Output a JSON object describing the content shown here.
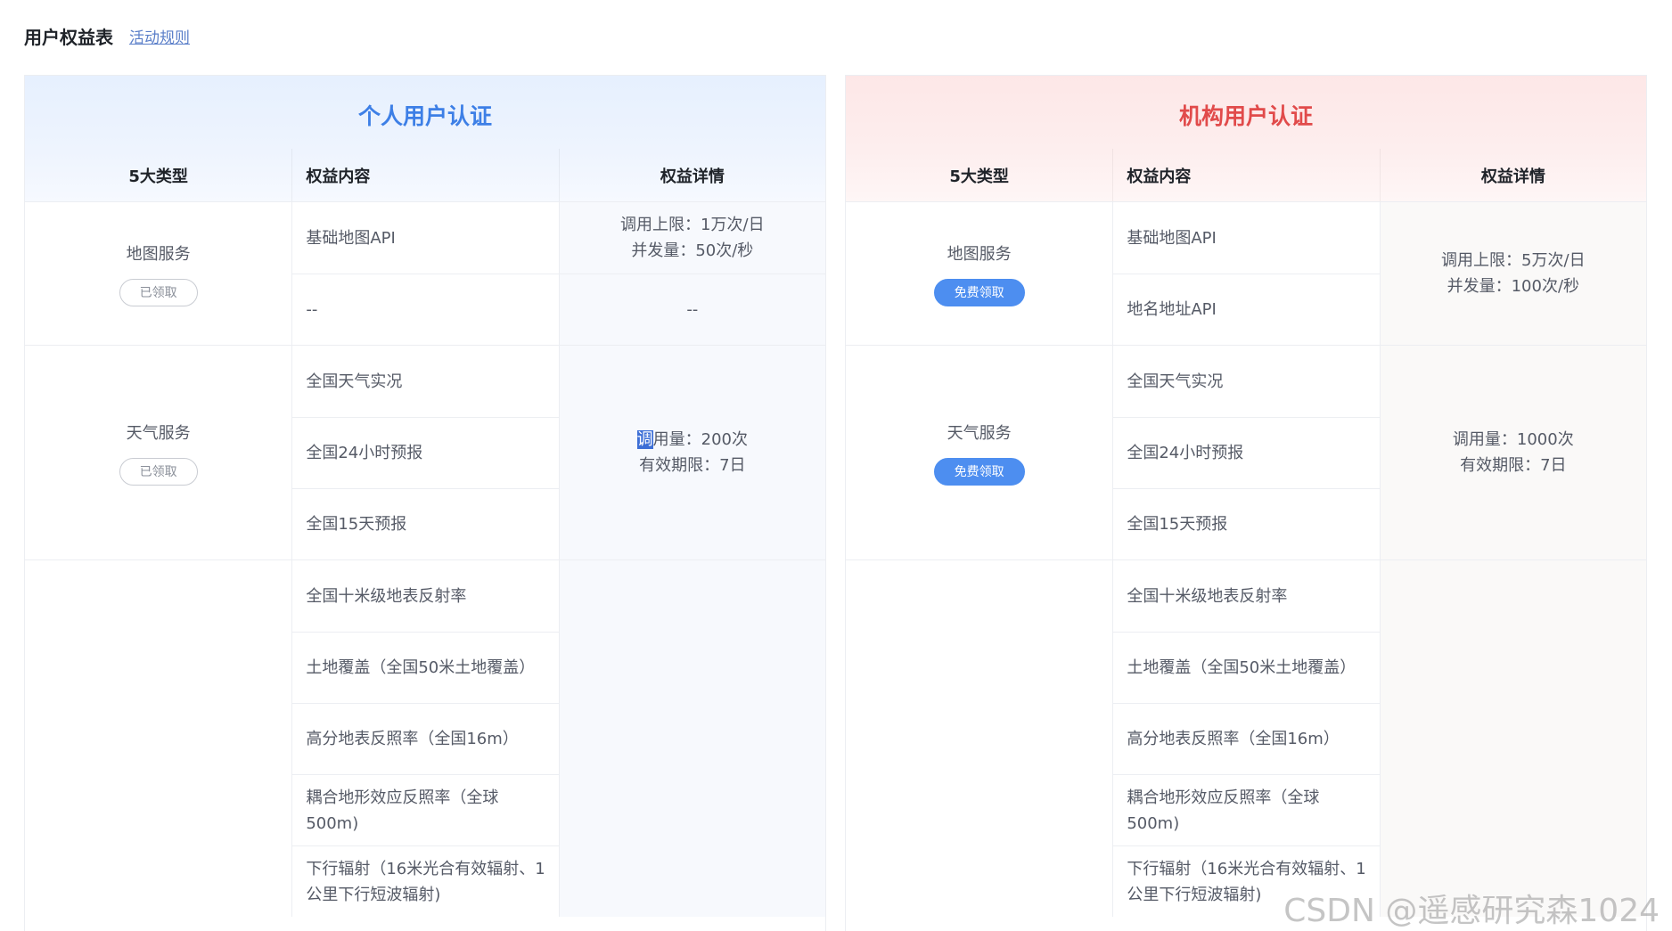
{
  "header": {
    "title": "用户权益表",
    "rules_link": "活动规则"
  },
  "columns": {
    "type": "5大类型",
    "content": "权益内容",
    "detail": "权益详情"
  },
  "personal": {
    "title": "个人用户认证",
    "groups": [
      {
        "type": "地图服务",
        "badge": "已领取",
        "items": [
          "基础地图API",
          "--"
        ],
        "details": [
          [
            "调用上限：1万次/日",
            "并发量：50次/秒"
          ],
          [
            "--"
          ]
        ]
      },
      {
        "type": "天气服务",
        "badge": "已领取",
        "items": [
          "全国天气实况",
          "全国24小时预报",
          "全国15天预报"
        ],
        "detail_highlight": "调",
        "detail_line1_rest": "用量：200次",
        "detail_line2": "有效期限：7日"
      },
      {
        "items": [
          "全国十米级地表反射率",
          "土地覆盖（全国50米土地覆盖）",
          "高分地表反照率（全国16m）",
          "耦合地形效应反照率（全球500m)",
          "下行辐射（16米光合有效辐射、1公里下行短波辐射)"
        ]
      }
    ]
  },
  "org": {
    "title": "机构用户认证",
    "groups": [
      {
        "type": "地图服务",
        "badge": "免费领取",
        "items": [
          "基础地图API",
          "地名地址API"
        ],
        "detail": [
          "调用上限：5万次/日",
          "并发量：100次/秒"
        ]
      },
      {
        "type": "天气服务",
        "badge": "免费领取",
        "items": [
          "全国天气实况",
          "全国24小时预报",
          "全国15天预报"
        ],
        "detail": [
          "调用量：1000次",
          "有效期限：7日"
        ]
      },
      {
        "items": [
          "全国十米级地表反射率",
          "土地覆盖（全国50米土地覆盖）",
          "高分地表反照率（全国16m）",
          "耦合地形效应反照率（全球500m)",
          "下行辐射（16米光合有效辐射、1公里下行短波辐射)"
        ]
      }
    ]
  },
  "watermark": "CSDN @遥感研究森1024"
}
